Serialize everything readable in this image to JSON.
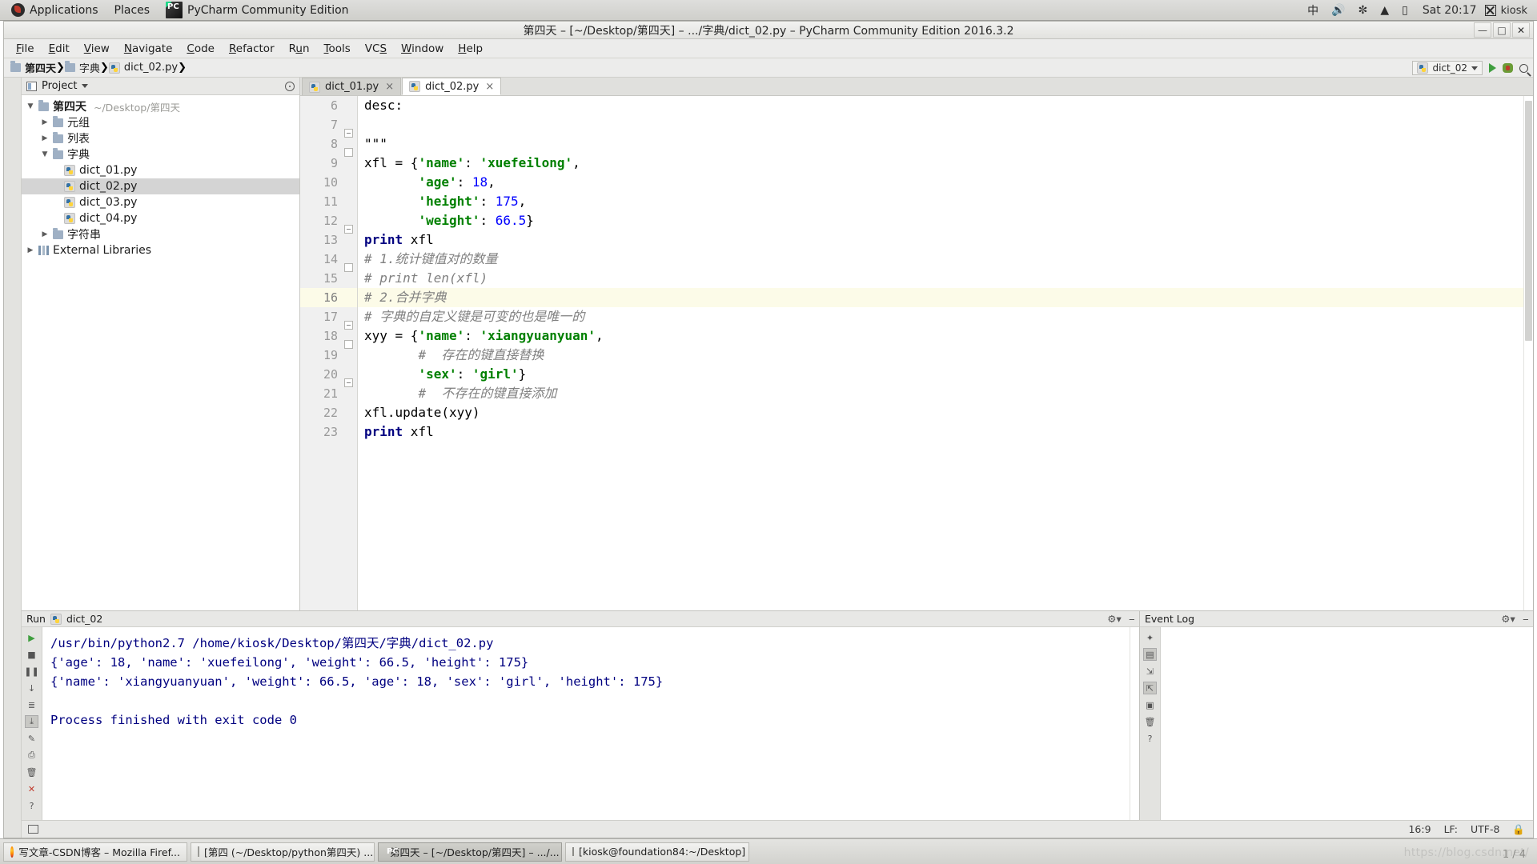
{
  "desktop": {
    "panel": {
      "applications": "Applications",
      "places": "Places",
      "active_app": "PyCharm Community Edition",
      "tray": {
        "input_method": "中",
        "volume_icon": "volume-icon",
        "bluetooth_icon": "bluetooth-icon",
        "wifi_icon": "wifi-icon",
        "battery_icon": "battery-icon"
      },
      "clock": "Sat 20:17",
      "user": "kiosk"
    }
  },
  "window": {
    "title": "第四天 – [~/Desktop/第四天] – .../字典/dict_02.py – PyCharm Community Edition 2016.3.2",
    "minimize": "—",
    "maximize": "□",
    "close": "✕"
  },
  "menubar": {
    "items": [
      {
        "label": "File"
      },
      {
        "label": "Edit"
      },
      {
        "label": "View"
      },
      {
        "label": "Navigate"
      },
      {
        "label": "Code"
      },
      {
        "label": "Refactor"
      },
      {
        "label": "Run"
      },
      {
        "label": "Tools"
      },
      {
        "label": "VCS"
      },
      {
        "label": "Window"
      },
      {
        "label": "Help"
      }
    ]
  },
  "navbar": {
    "crumbs": [
      {
        "label": "第四天",
        "icon": "folder-icon"
      },
      {
        "label": "字典",
        "icon": "folder-icon"
      },
      {
        "label": "dict_02.py",
        "icon": "python-file-icon"
      }
    ],
    "run_configuration": "dict_02",
    "run_button": "run-icon",
    "debug_button": "debug-icon",
    "search_button": "search-icon"
  },
  "project": {
    "header_title": "Project",
    "tree": [
      {
        "indent": 0,
        "arrow": "▼",
        "icon": "folder-icon",
        "label": "第四天",
        "path": "~/Desktop/第四天",
        "bold": true,
        "selected": false
      },
      {
        "indent": 1,
        "arrow": "▶",
        "icon": "folder-icon",
        "label": "元组",
        "path": "",
        "bold": false,
        "selected": false
      },
      {
        "indent": 1,
        "arrow": "▶",
        "icon": "folder-icon",
        "label": "列表",
        "path": "",
        "bold": false,
        "selected": false
      },
      {
        "indent": 1,
        "arrow": "▼",
        "icon": "folder-icon",
        "label": "字典",
        "path": "",
        "bold": false,
        "selected": false
      },
      {
        "indent": 2,
        "arrow": "",
        "icon": "python-file-icon",
        "label": "dict_01.py",
        "path": "",
        "bold": false,
        "selected": false
      },
      {
        "indent": 2,
        "arrow": "",
        "icon": "python-file-icon",
        "label": "dict_02.py",
        "path": "",
        "bold": false,
        "selected": true
      },
      {
        "indent": 2,
        "arrow": "",
        "icon": "python-file-icon",
        "label": "dict_03.py",
        "path": "",
        "bold": false,
        "selected": false
      },
      {
        "indent": 2,
        "arrow": "",
        "icon": "python-file-icon",
        "label": "dict_04.py",
        "path": "",
        "bold": false,
        "selected": false
      },
      {
        "indent": 1,
        "arrow": "▶",
        "icon": "folder-icon",
        "label": "字符串",
        "path": "",
        "bold": false,
        "selected": false
      },
      {
        "indent": 0,
        "arrow": "▶",
        "icon": "library-icon",
        "label": "External Libraries",
        "path": "",
        "bold": false,
        "selected": false
      }
    ]
  },
  "editor": {
    "tabs": [
      {
        "label": "dict_01.py",
        "active": false,
        "close": "×"
      },
      {
        "label": "dict_02.py",
        "active": true,
        "close": "×"
      }
    ],
    "current_line": 16,
    "lines": [
      {
        "n": 6,
        "tokens": [
          {
            "t": "desc:",
            "c": "plain"
          }
        ]
      },
      {
        "n": 7,
        "tokens": [
          {
            "t": "",
            "c": "plain"
          }
        ]
      },
      {
        "n": 8,
        "tokens": [
          {
            "t": "\"\"\"",
            "c": "plain"
          }
        ]
      },
      {
        "n": 9,
        "tokens": [
          {
            "t": "xfl = {",
            "c": "plain"
          },
          {
            "t": "'name'",
            "c": "str"
          },
          {
            "t": ": ",
            "c": "plain"
          },
          {
            "t": "'xuefeilong'",
            "c": "str"
          },
          {
            "t": ",",
            "c": "plain"
          }
        ]
      },
      {
        "n": 10,
        "tokens": [
          {
            "t": "       ",
            "c": "plain"
          },
          {
            "t": "'age'",
            "c": "str"
          },
          {
            "t": ": ",
            "c": "plain"
          },
          {
            "t": "18",
            "c": "num"
          },
          {
            "t": ",",
            "c": "plain"
          }
        ]
      },
      {
        "n": 11,
        "tokens": [
          {
            "t": "       ",
            "c": "plain"
          },
          {
            "t": "'height'",
            "c": "str"
          },
          {
            "t": ": ",
            "c": "plain"
          },
          {
            "t": "175",
            "c": "num"
          },
          {
            "t": ",",
            "c": "plain"
          }
        ]
      },
      {
        "n": 12,
        "tokens": [
          {
            "t": "       ",
            "c": "plain"
          },
          {
            "t": "'weight'",
            "c": "str"
          },
          {
            "t": ": ",
            "c": "plain"
          },
          {
            "t": "66.5",
            "c": "num"
          },
          {
            "t": "}",
            "c": "plain"
          }
        ]
      },
      {
        "n": 13,
        "tokens": [
          {
            "t": "print",
            "c": "kw"
          },
          {
            "t": " xfl",
            "c": "plain"
          }
        ]
      },
      {
        "n": 14,
        "tokens": [
          {
            "t": "# 1.统计键值对的数量",
            "c": "cmt"
          }
        ]
      },
      {
        "n": 15,
        "tokens": [
          {
            "t": "# print len(xfl)",
            "c": "cmt"
          }
        ]
      },
      {
        "n": 16,
        "tokens": [
          {
            "t": "# 2.合并字典",
            "c": "cmt"
          }
        ]
      },
      {
        "n": 17,
        "tokens": [
          {
            "t": "# 字典的自定义键是可变的也是唯一的",
            "c": "cmt"
          }
        ]
      },
      {
        "n": 18,
        "tokens": [
          {
            "t": "xyy = {",
            "c": "plain"
          },
          {
            "t": "'name'",
            "c": "str"
          },
          {
            "t": ": ",
            "c": "plain"
          },
          {
            "t": "'xiangyuanyuan'",
            "c": "str"
          },
          {
            "t": ",",
            "c": "plain"
          }
        ]
      },
      {
        "n": 19,
        "tokens": [
          {
            "t": "       ",
            "c": "plain"
          },
          {
            "t": "#  存在的键直接替换",
            "c": "cmt"
          }
        ]
      },
      {
        "n": 20,
        "tokens": [
          {
            "t": "       ",
            "c": "plain"
          },
          {
            "t": "'sex'",
            "c": "str"
          },
          {
            "t": ": ",
            "c": "plain"
          },
          {
            "t": "'girl'",
            "c": "str"
          },
          {
            "t": "}",
            "c": "plain"
          }
        ]
      },
      {
        "n": 21,
        "tokens": [
          {
            "t": "       ",
            "c": "plain"
          },
          {
            "t": "#  不存在的键直接添加",
            "c": "cmt"
          }
        ]
      },
      {
        "n": 22,
        "tokens": [
          {
            "t": "xfl.update(xyy)",
            "c": "plain"
          }
        ]
      },
      {
        "n": 23,
        "tokens": [
          {
            "t": "print",
            "c": "kw"
          },
          {
            "t": " xfl",
            "c": "plain"
          }
        ]
      }
    ]
  },
  "run_tool": {
    "title": "Run",
    "config_name": "dict_02",
    "settings_icon": "gear-icon",
    "minimize_icon": "minimize-icon",
    "output": [
      "/usr/bin/python2.7 /home/kiosk/Desktop/第四天/字典/dict_02.py",
      "{'age': 18, 'name': 'xuefeilong', 'weight': 66.5, 'height': 175}",
      "{'name': 'xiangyuanyuan', 'weight': 66.5, 'age': 18, 'sex': 'girl', 'height': 175}",
      "",
      "Process finished with exit code 0"
    ],
    "side_buttons": [
      {
        "name": "rerun-icon",
        "glyph": "▶",
        "active": false
      },
      {
        "name": "stop-icon",
        "glyph": "■",
        "active": false
      },
      {
        "name": "pause-icon",
        "glyph": "❚❚",
        "active": false
      },
      {
        "name": "down-arrow-icon",
        "glyph": "↓",
        "active": false
      },
      {
        "name": "soft-wrap-icon",
        "glyph": "≡",
        "active": false
      },
      {
        "name": "scroll-to-end-icon",
        "glyph": "⤓",
        "active": true
      },
      {
        "name": "pin-icon",
        "glyph": "✎",
        "active": false
      },
      {
        "name": "print-icon",
        "glyph": "⎙",
        "active": false
      },
      {
        "name": "trash-icon",
        "glyph": "🗑",
        "active": false
      },
      {
        "name": "close-icon",
        "glyph": "✕",
        "active": false
      },
      {
        "name": "help-icon",
        "glyph": "?",
        "active": false
      }
    ]
  },
  "event_log": {
    "title": "Event Log",
    "settings_icon": "gear-icon",
    "minimize_icon": "minimize-icon",
    "side_buttons": [
      {
        "name": "settings-icon",
        "glyph": "✦",
        "active": false
      },
      {
        "name": "wrap-icon",
        "glyph": "▤",
        "active": true
      },
      {
        "name": "expand-icon",
        "glyph": "⇲",
        "active": false
      },
      {
        "name": "collapse-icon",
        "glyph": "⇱",
        "active": true
      },
      {
        "name": "preview-icon",
        "glyph": "▣",
        "active": false
      },
      {
        "name": "trash-icon",
        "glyph": "🗑",
        "active": false
      },
      {
        "name": "help-icon",
        "glyph": "?",
        "active": false
      }
    ]
  },
  "status_bar": {
    "left_icon": "event-log-icon",
    "caret_position": "16:9",
    "line_separator": "LF:",
    "encoding": "UTF-8",
    "lock_icon": "lock-icon"
  },
  "taskbar": {
    "items": [
      {
        "label": "写文章-CSDN博客 – Mozilla Firef...",
        "icon": "firefox-icon",
        "active": false
      },
      {
        "label": "[第四 (~/Desktop/python第四天) ...",
        "icon": "editor-icon",
        "active": false
      },
      {
        "label": "第四天 – [~/Desktop/第四天] – .../...",
        "icon": "pycharm-icon",
        "active": true
      },
      {
        "label": "[kiosk@foundation84:~/Desktop]",
        "icon": "terminal-icon",
        "active": false
      }
    ],
    "watermark": "https://blog.csdn.net/",
    "page_count": "1 / 4"
  },
  "colors": {
    "accent_green": "#008000",
    "accent_blue": "#0000ff",
    "keyword_navy": "#000080",
    "comment_gray": "#808080",
    "current_line": "#fcfbe8",
    "selection": "#d4d4d4"
  }
}
